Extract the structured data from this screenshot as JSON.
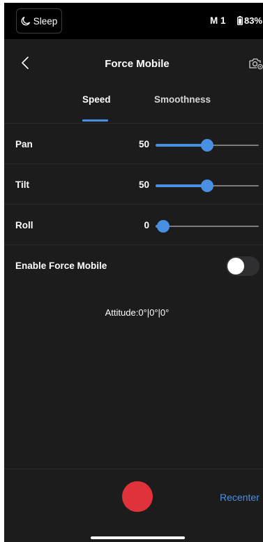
{
  "status_bar": {
    "sleep_label": "Sleep",
    "mode_label": "M 1",
    "battery_label": "83%",
    "battery_level": 0.83
  },
  "header": {
    "title": "Force Mobile",
    "back_icon": "chevron-left-icon",
    "camera_icon": "camera-settings-icon"
  },
  "tabs": [
    {
      "label": "Speed",
      "active": true
    },
    {
      "label": "Smoothness",
      "active": false
    }
  ],
  "settings": {
    "pan": {
      "label": "Pan",
      "value": "50",
      "fraction": 0.5
    },
    "tilt": {
      "label": "Tilt",
      "value": "50",
      "fraction": 0.5
    },
    "roll": {
      "label": "Roll",
      "value": "0",
      "fraction": 0.0
    },
    "enable": {
      "label": "Enable Force Mobile",
      "on": false
    }
  },
  "attitude": "Attitude:0°|0°|0°",
  "footer": {
    "recenter_label": "Recenter",
    "record_color": "#e0323a"
  },
  "colors": {
    "accent": "#4a90e2",
    "background": "#1c1c1d"
  }
}
